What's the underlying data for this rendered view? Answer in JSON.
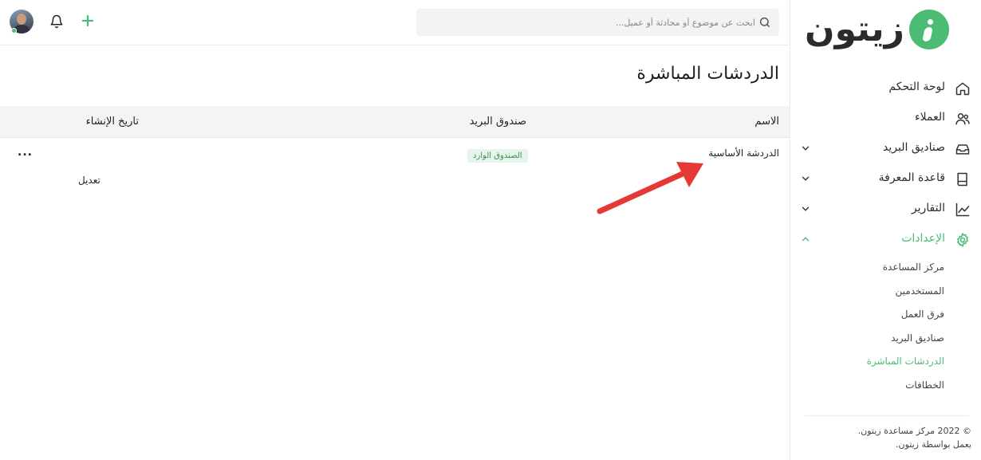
{
  "brand": {
    "logo_text": "زيتون",
    "accent": "#4cbb74"
  },
  "topbar": {
    "search_placeholder": "ابحث عن موضوع أو محادثة أو عميل...",
    "icons": [
      "search-icon",
      "bell-icon",
      "plus-icon"
    ]
  },
  "sidebar": {
    "items": [
      {
        "label": "لوحة التحكم",
        "icon": "home-icon"
      },
      {
        "label": "العملاء",
        "icon": "users-icon"
      },
      {
        "label": "صناديق البريد",
        "icon": "inbox-icon",
        "expandable": true
      },
      {
        "label": "قاعدة المعرفة",
        "icon": "book-icon",
        "expandable": true
      },
      {
        "label": "التقارير",
        "icon": "chart-icon",
        "expandable": true
      },
      {
        "label": "الإعدادات",
        "icon": "settings-icon",
        "expandable": true,
        "expanded": true,
        "active": true
      }
    ],
    "settings_sub": [
      {
        "label": "مركز المساعدة"
      },
      {
        "label": "المستخدمين"
      },
      {
        "label": "فرق العمل"
      },
      {
        "label": "صناديق البريد"
      },
      {
        "label": "الدردشات المباشرة",
        "active": true
      },
      {
        "label": "الخطافات"
      }
    ],
    "footer_line1": "© 2022 مركز مساعدة زيتون.",
    "footer_line2": "يعمل بواسطة زيتون."
  },
  "main": {
    "title": "الدردشات المباشرة",
    "columns": {
      "name": "الاسم",
      "mailbox": "صندوق البريد",
      "created": "تاريخ الإنشاء"
    },
    "rows": [
      {
        "name": "الدردشة الأساسية",
        "mailbox": "الصندوق الوارد",
        "actions_label": "...",
        "edit_label": "تعديل"
      }
    ]
  }
}
